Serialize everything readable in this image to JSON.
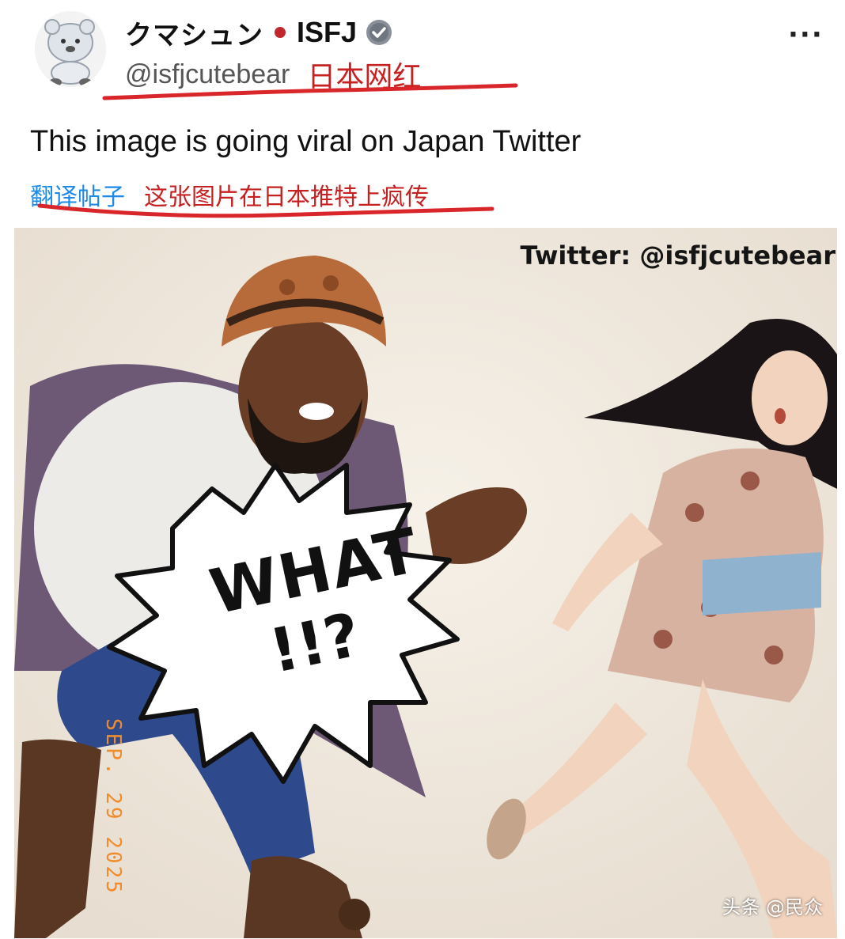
{
  "post": {
    "display_name": "クマシュン",
    "type_tag": "ISFJ",
    "handle": "@isfjcutebear",
    "annotation_cn": "日本网红",
    "text": "This image is going viral on Japan Twitter",
    "translate_label": "翻译帖子",
    "translation_cn": "这张图片在日本推特上疯传",
    "more_label": "···"
  },
  "media": {
    "watermark": "Twitter: @isfjcutebear",
    "burst_text_line1": "WHAT",
    "burst_text_line2": "!!?",
    "date_stamp": "SEP. 29 2025",
    "source_mark": "头条 @民众"
  },
  "colors": {
    "annotation_red": "#c62020",
    "link_blue": "#1d8ae8",
    "status_dot": "#c1272d",
    "verified_blue": "#1d9bf0",
    "date_orange": "#f08c2c"
  },
  "icons": [
    "avatar-bear-icon",
    "status-dot-icon",
    "verified-badge-icon",
    "more-options-icon"
  ]
}
